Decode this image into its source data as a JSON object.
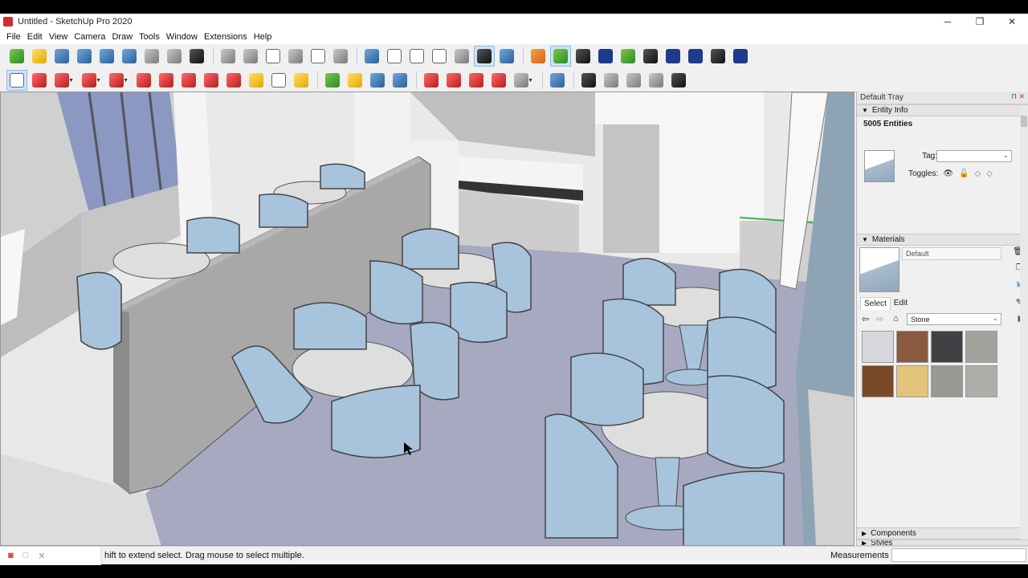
{
  "window": {
    "title": "Untitled - SketchUp Pro 2020",
    "minimize": "─",
    "maximize": "❐",
    "close": "✕"
  },
  "menu": [
    "File",
    "Edit",
    "View",
    "Camera",
    "Draw",
    "Tools",
    "Window",
    "Extensions",
    "Help"
  ],
  "toolbar1": [
    {
      "name": "orbit-icon",
      "style": "g-green"
    },
    {
      "name": "pan-icon",
      "style": "g-yellow"
    },
    {
      "name": "zoom-icon",
      "style": "g-blue"
    },
    {
      "name": "zoom-window-icon",
      "style": "g-blue"
    },
    {
      "name": "zoom-extents-icon",
      "style": "g-blue"
    },
    {
      "name": "previous-view-icon",
      "style": "g-blue"
    },
    {
      "name": "position-camera-icon",
      "style": "g-grey"
    },
    {
      "name": "look-around-icon",
      "style": "g-grey"
    },
    {
      "name": "walk-icon",
      "style": "g-dark"
    },
    {
      "sep": true
    },
    {
      "name": "iso-view-icon",
      "style": "g-grey"
    },
    {
      "name": "top-view-icon",
      "style": "g-grey"
    },
    {
      "name": "front-view-icon",
      "style": "g-white"
    },
    {
      "name": "right-view-icon",
      "style": "g-grey"
    },
    {
      "name": "back-view-icon",
      "style": "g-white"
    },
    {
      "name": "left-view-icon",
      "style": "g-grey"
    },
    {
      "sep": true
    },
    {
      "name": "xray-icon",
      "style": "g-blue"
    },
    {
      "name": "back-edges-icon",
      "style": "g-white"
    },
    {
      "name": "wireframe-icon",
      "style": "g-white"
    },
    {
      "name": "hidden-line-icon",
      "style": "g-white"
    },
    {
      "name": "shaded-icon",
      "style": "g-grey"
    },
    {
      "name": "shaded-textures-icon",
      "style": "g-dark",
      "active": true
    },
    {
      "name": "monochrome-icon",
      "style": "g-blue"
    },
    {
      "sep": true
    },
    {
      "name": "3d-warehouse-icon",
      "style": "g-orange"
    },
    {
      "name": "reload-icon",
      "style": "g-green",
      "active": true
    },
    {
      "name": "layers-stack-icon",
      "style": "g-dark"
    },
    {
      "name": "add-location-icon",
      "style": "g-navy"
    },
    {
      "name": "tree-icon",
      "style": "g-green"
    },
    {
      "name": "checker-icon",
      "style": "g-dark"
    },
    {
      "name": "cloud-upload-icon",
      "style": "g-navy"
    },
    {
      "name": "settings-gears-icon",
      "style": "g-navy"
    },
    {
      "name": "mail-icon",
      "style": "g-dark"
    },
    {
      "name": "info-icon",
      "style": "g-navy"
    }
  ],
  "toolbar2": [
    {
      "name": "select-icon",
      "style": "g-white",
      "active": true
    },
    {
      "name": "eraser-icon",
      "style": "g-red"
    },
    {
      "name": "line-icon",
      "style": "g-red",
      "drop": true
    },
    {
      "name": "arc-icon",
      "style": "g-red",
      "drop": true
    },
    {
      "name": "rectangle-icon",
      "style": "g-red",
      "drop": true
    },
    {
      "name": "push-pull-icon",
      "style": "g-red"
    },
    {
      "name": "follow-me-icon",
      "style": "g-red"
    },
    {
      "name": "move-icon",
      "style": "g-red"
    },
    {
      "name": "rotate-icon",
      "style": "g-red"
    },
    {
      "name": "scale-icon",
      "style": "g-red"
    },
    {
      "name": "offset-icon",
      "style": "g-yellow"
    },
    {
      "name": "text-icon",
      "style": "g-white"
    },
    {
      "name": "paint-bucket-icon",
      "style": "g-yellow"
    },
    {
      "sep": true
    },
    {
      "name": "orbit-small-icon",
      "style": "g-green"
    },
    {
      "name": "hand-icon",
      "style": "g-yellow"
    },
    {
      "name": "zoom-small-icon",
      "style": "g-blue"
    },
    {
      "name": "zoom-extents-small-icon",
      "style": "g-blue"
    },
    {
      "sep": true
    },
    {
      "name": "solid-tools-icon",
      "style": "g-red"
    },
    {
      "name": "sandbox-icon",
      "style": "g-red"
    },
    {
      "name": "styles-icon",
      "style": "g-red"
    },
    {
      "name": "ruby-icon",
      "style": "g-red"
    },
    {
      "name": "geo-location-icon",
      "style": "g-grey",
      "drop": true
    },
    {
      "sep": true
    },
    {
      "name": "lumion-icon",
      "style": "g-blue"
    },
    {
      "sep": true
    },
    {
      "name": "play-icon",
      "style": "g-dark"
    },
    {
      "name": "stop-icon",
      "style": "g-grey"
    },
    {
      "name": "scene-icon",
      "style": "g-grey"
    },
    {
      "name": "scene-remove-icon",
      "style": "g-grey"
    },
    {
      "name": "gear-icon",
      "style": "g-dark"
    }
  ],
  "tray": {
    "title": "Default Tray",
    "pin": "⊓",
    "close": "✕",
    "entity_info": {
      "header": "Entity Info",
      "count": "5005 Entities",
      "tag_label": "Tag:",
      "tag_value": "",
      "toggles_label": "Toggles:"
    },
    "materials": {
      "header": "Materials",
      "name": "Default",
      "tab_select": "Select",
      "tab_edit": "Edit",
      "library": "Stone",
      "swatches": [
        "#d6d8dc",
        "#8a5a3e",
        "#3f4144",
        "#a4a29c",
        "#7a4a28",
        "#e3c47a",
        "#9a9893",
        "#b0aeab"
      ]
    },
    "components": {
      "header": "Components"
    },
    "styles": {
      "header": "Styles"
    }
  },
  "status": {
    "hint": "hift to extend select. Drag mouse to select multiple.",
    "measurements_label": "Measurements",
    "measurements_value": ""
  },
  "accent": {
    "select_blue": "#cfe3f5",
    "floor": "#a6a9c0",
    "chair": "#a8c4dc"
  }
}
